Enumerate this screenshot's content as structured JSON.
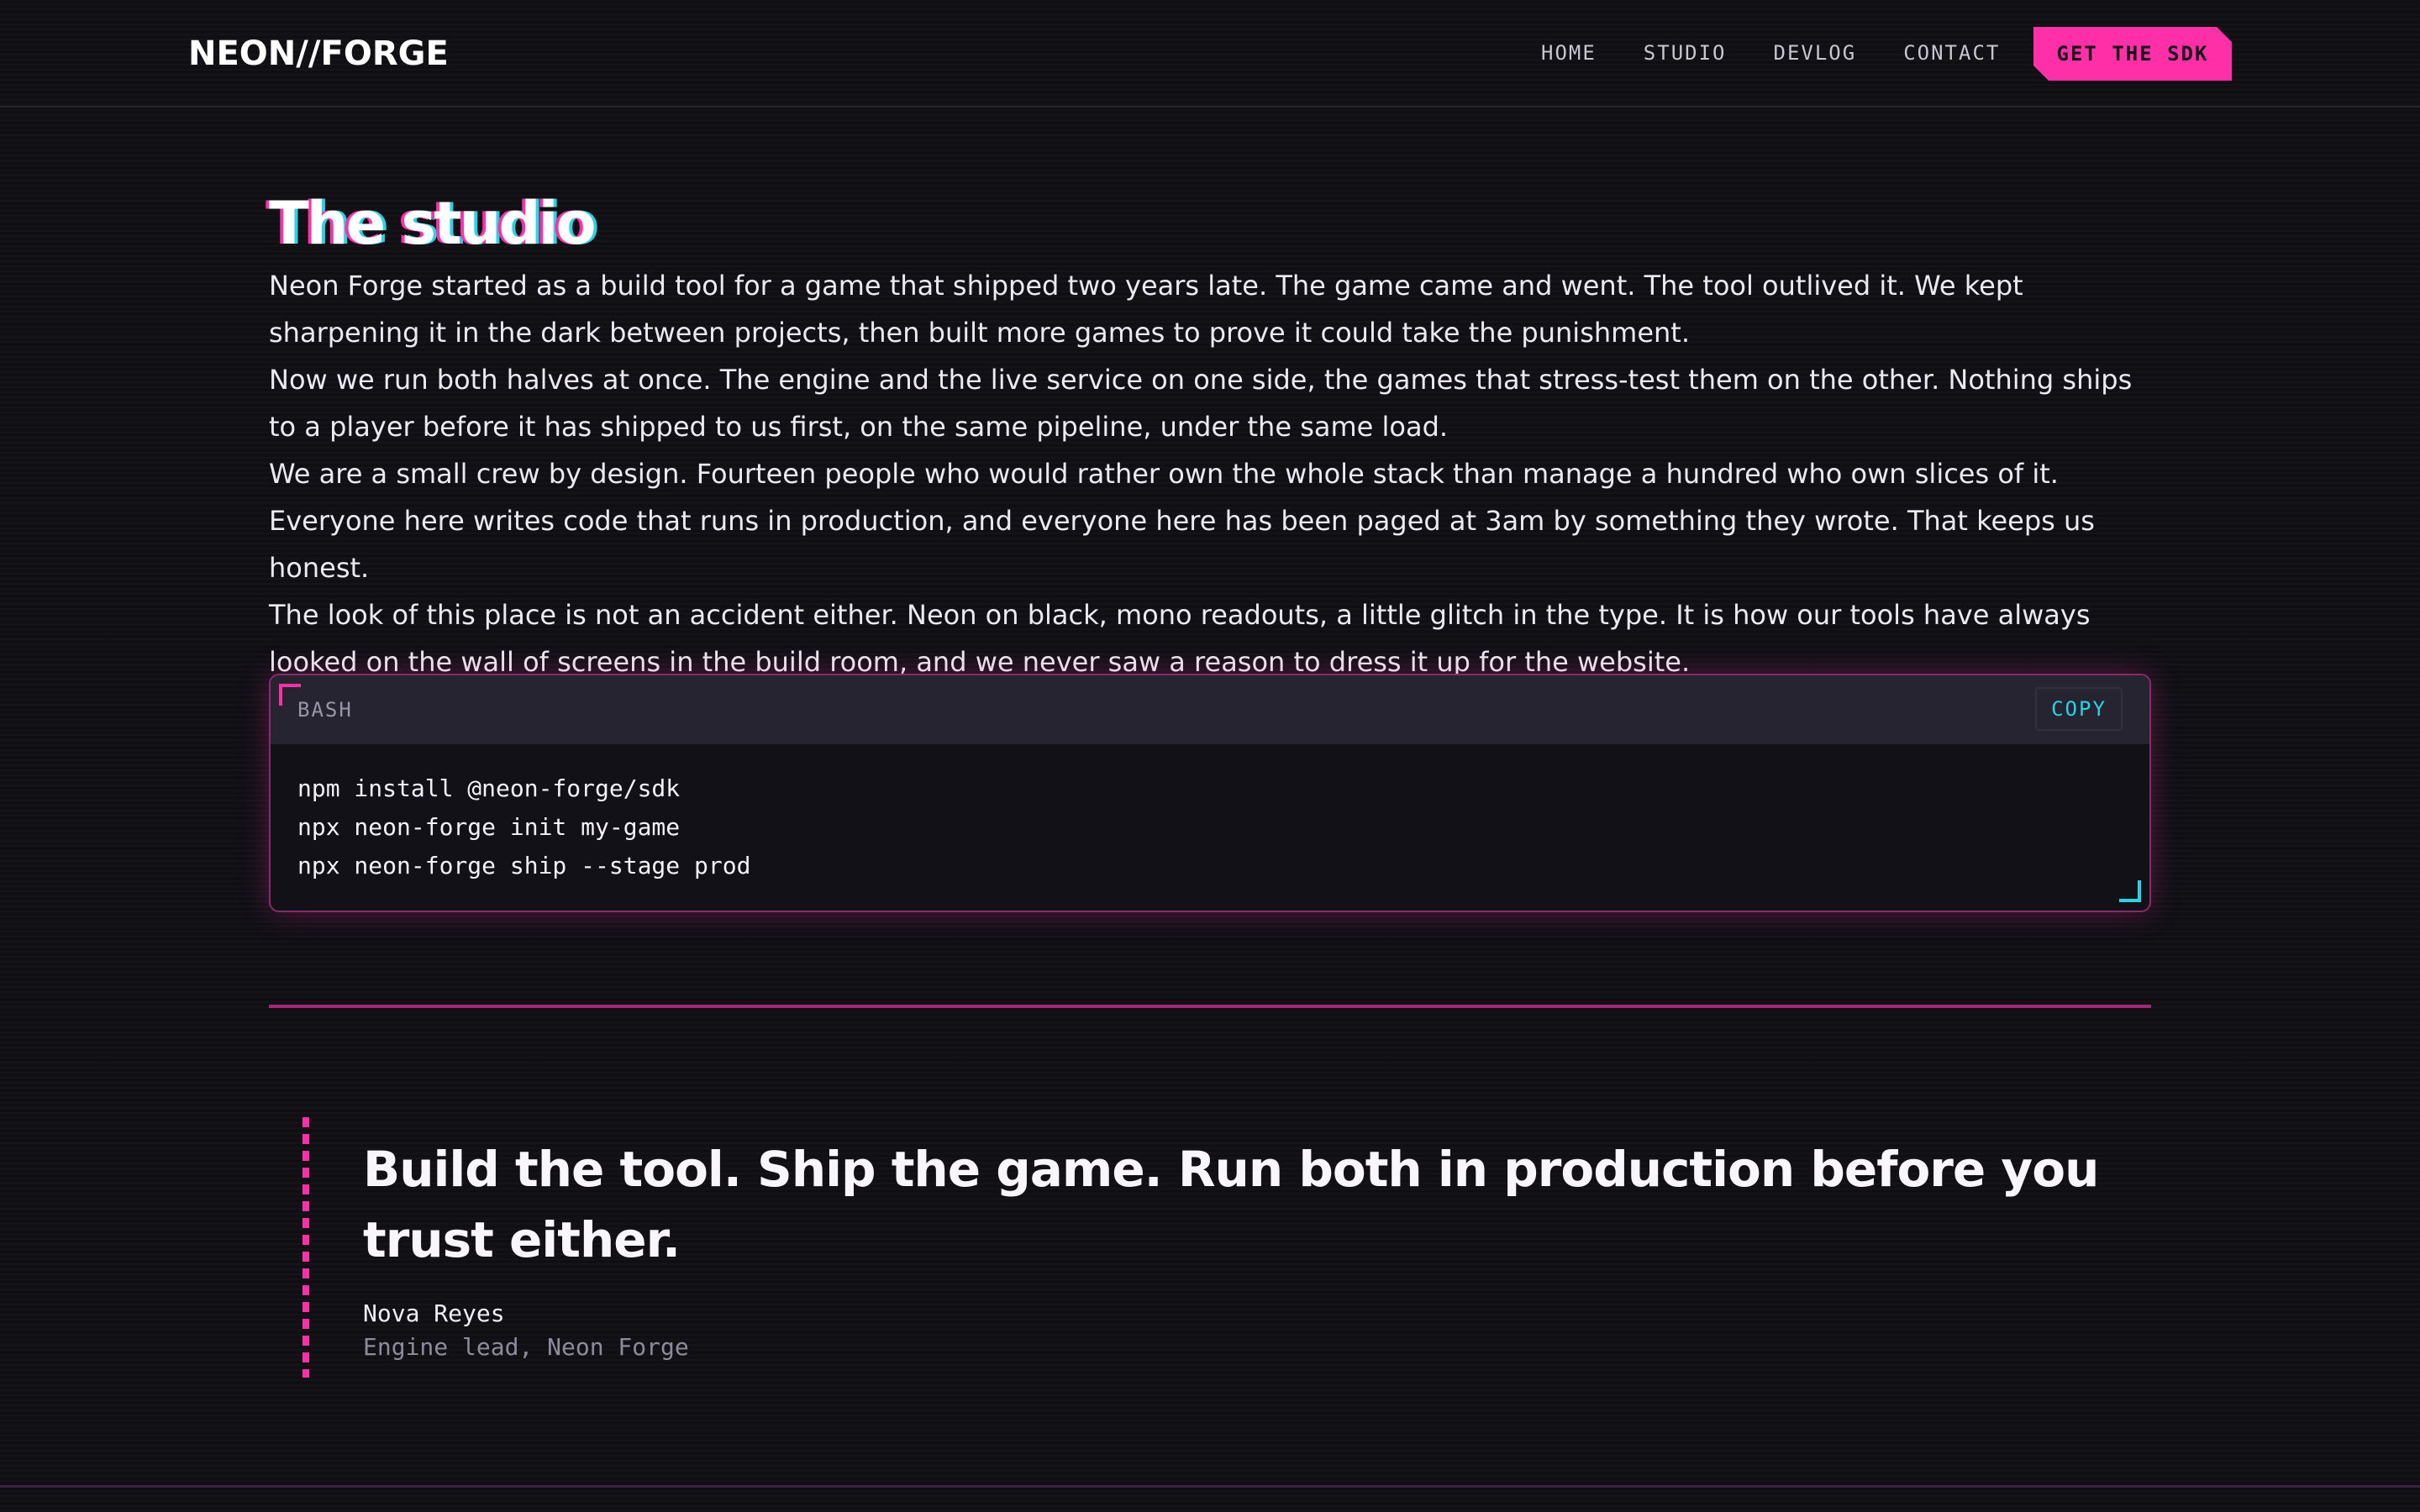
{
  "header": {
    "brand": "NEON//FORGE",
    "nav": [
      {
        "label": "HOME"
      },
      {
        "label": "STUDIO"
      },
      {
        "label": "DEVLOG"
      },
      {
        "label": "CONTACT"
      }
    ],
    "cta_label": "GET THE SDK"
  },
  "main": {
    "title": "The studio",
    "paragraphs": [
      "Neon Forge started as a build tool for a game that shipped two years late. The game came and went. The tool outlived it. We kept sharpening it in the dark between projects, then built more games to prove it could take the punishment.",
      "Now we run both halves at once. The engine and the live service on one side, the games that stress-test them on the other. Nothing ships to a player before it has shipped to us first, on the same pipeline, under the same load.",
      "We are a small crew by design. Fourteen people who would rather own the whole stack than manage a hundred who own slices of it. Everyone here writes code that runs in production, and everyone here has been paged at 3am by something they wrote. That keeps us honest.",
      "The look of this place is not an accident either. Neon on black, mono readouts, a little glitch in the type. It is how our tools have always looked on the wall of screens in the build room, and we never saw a reason to dress it up for the website."
    ]
  },
  "code": {
    "language": "BASH",
    "copy_label": "COPY",
    "lines": [
      "npm install @neon-forge/sdk",
      "npx neon-forge init my-game",
      "npx neon-forge ship --stage prod"
    ]
  },
  "quote": {
    "text": "Build the tool. Ship the game. Run both in production before you trust either.",
    "author": "Nova Reyes",
    "role": "Engine lead, Neon Forge"
  },
  "colors": {
    "background": "#0f0f14",
    "accent_pink": "#ff2fa8",
    "accent_cyan": "#25d6e6",
    "text": "#f2f0f5",
    "muted": "#8f8b9c"
  },
  "icons": {
    "code_corner_top_left": "corner-bracket-icon",
    "code_corner_bottom_right": "corner-bracket-icon"
  }
}
